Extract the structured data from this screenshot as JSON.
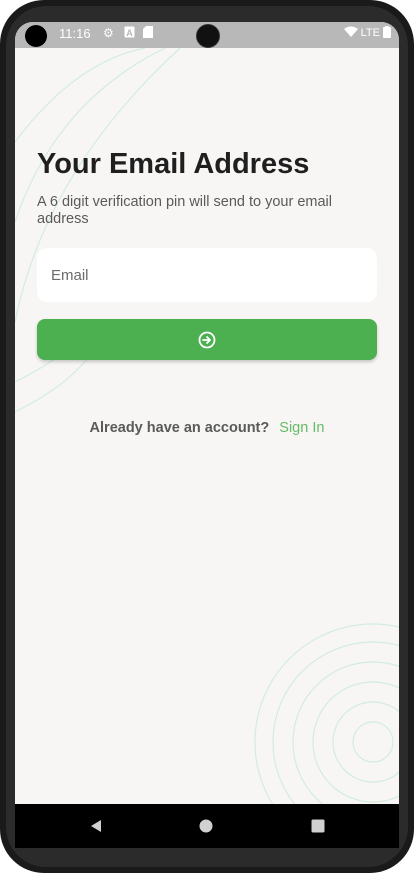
{
  "status_bar": {
    "time": "11:16",
    "icons": [
      "gear-icon",
      "a-icon",
      "sd-card-icon"
    ],
    "network": "LTE"
  },
  "main": {
    "title": "Your Email Address",
    "subtitle": "A 6 digit verification pin will send to your email address",
    "email_placeholder": "Email",
    "email_value": "",
    "submit_icon": "arrow-right-circle-icon"
  },
  "footer": {
    "prompt": "Already have an account?",
    "link": "Sign In"
  },
  "colors": {
    "accent": "#4caf50",
    "link": "#66bb6a",
    "background": "#f7f6f4"
  },
  "nav": {
    "icons": [
      "back-icon",
      "home-icon",
      "recents-icon"
    ]
  }
}
